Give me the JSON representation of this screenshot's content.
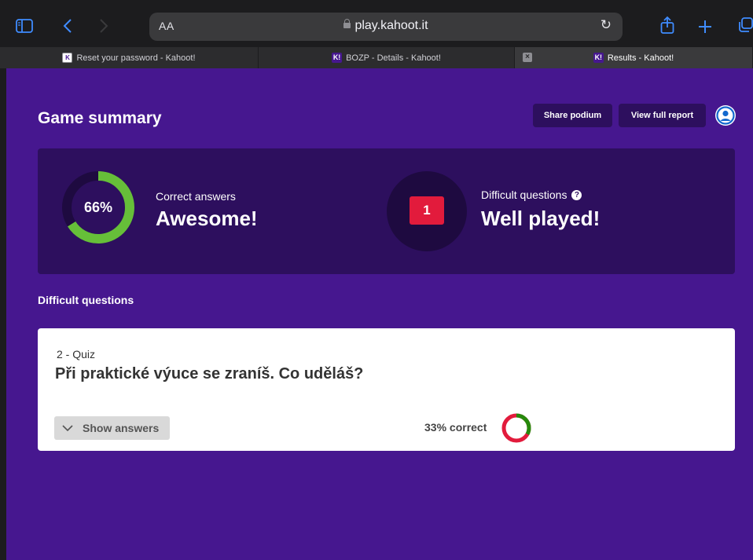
{
  "browser": {
    "address_aa": "AA",
    "url": "play.kahoot.it"
  },
  "tabs": [
    {
      "title": "Reset your password - Kahoot!",
      "favicon": "K"
    },
    {
      "title": "BOZP - Details - Kahoot!",
      "favicon": "K!"
    },
    {
      "title": "Results - Kahoot!",
      "favicon": "K!",
      "active": true
    }
  ],
  "header": {
    "title": "Game summary",
    "share_podium": "Share podium",
    "view_full_report": "View full report"
  },
  "summary": {
    "correct_percent_text": "66%",
    "correct_fraction": 0.66,
    "correct_label": "Correct answers",
    "correct_verdict": "Awesome!",
    "difficult_count": "1",
    "difficult_label": "Difficult questions",
    "difficult_verdict": "Well played!"
  },
  "difficult_section": {
    "heading": "Difficult questions",
    "questions": [
      {
        "type": "2 - Quiz",
        "text": "Při praktické výuce se zraníš. Co uděláš?",
        "show_answers": "Show answers",
        "correct_text": "33% correct",
        "correct_fraction": 0.33
      }
    ]
  },
  "colors": {
    "kahoot_purple": "#46178f",
    "panel_dark": "#2d0f5e",
    "correct_green": "#26890c",
    "ring_green": "#66bf39",
    "incorrect_red": "#e21b3c",
    "safari_blue": "#3f8cff"
  },
  "icons": [
    "sidebar-icon",
    "back-icon",
    "forward-icon",
    "lock-icon",
    "reload-icon",
    "share-icon",
    "new-tab-icon",
    "tabs-icon",
    "user-icon",
    "help-icon",
    "chevron-down-icon"
  ]
}
